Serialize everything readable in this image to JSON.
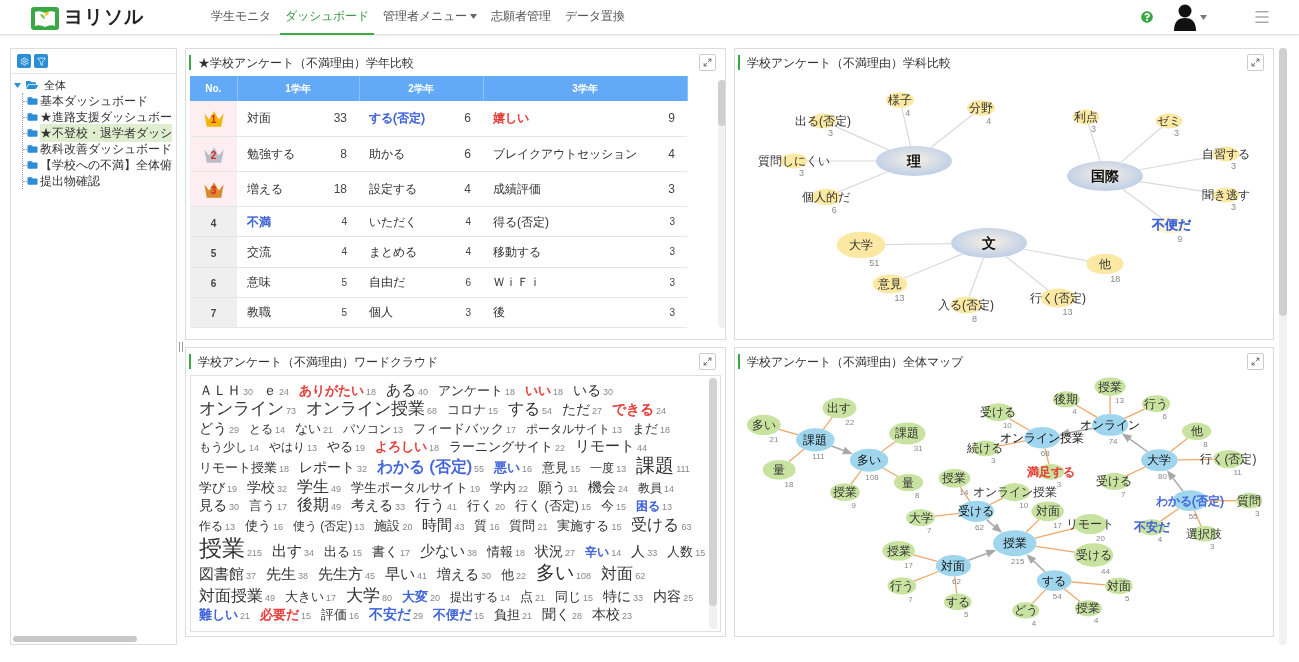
{
  "header": {
    "logo": "ヨリソル",
    "nav": [
      {
        "label": "学生モニタ",
        "selected": false,
        "has_menu": false
      },
      {
        "label": "ダッシュボード",
        "selected": true,
        "has_menu": false
      },
      {
        "label": "管理者メニュー",
        "selected": false,
        "has_menu": true
      },
      {
        "label": "志願者管理",
        "selected": false,
        "has_menu": false
      },
      {
        "label": "データ置換",
        "selected": false,
        "has_menu": false
      }
    ]
  },
  "sidebar": {
    "tree": [
      {
        "label": "全体",
        "expanded": true,
        "selected": false,
        "children": [
          {
            "label": "基本ダッシュボード",
            "selected": false
          },
          {
            "label": "★進路支援ダッシュボー",
            "selected": false
          },
          {
            "label": "★不登校・退学者ダッシ",
            "selected": true
          },
          {
            "label": "教科改善ダッシュボード",
            "selected": false
          },
          {
            "label": "【学校への不満】全体俯",
            "selected": false
          },
          {
            "label": "提出物確認",
            "selected": false
          }
        ]
      }
    ]
  },
  "grade_table": {
    "title": "★学校アンケート（不満理由）学年比較",
    "no_header": "No.",
    "grade_headers": [
      "1学年",
      "2学年",
      "3学年"
    ],
    "entries": [
      {
        "rank": "1",
        "kind": "gold",
        "grades": [
          {
            "word": "対面",
            "count": "33"
          },
          {
            "word": "する(否定)",
            "count": "6",
            "color": "#3b5fd8"
          },
          {
            "word": "嬉しい",
            "count": "9",
            "color": "#e53935"
          }
        ]
      },
      {
        "rank": "2",
        "kind": "silver",
        "grades": [
          {
            "word": "勉強する",
            "count": "8"
          },
          {
            "word": "助かる",
            "count": "6"
          },
          {
            "word": "ブレイクアウトセッション",
            "count": "4"
          }
        ]
      },
      {
        "rank": "3",
        "kind": "bronze",
        "grades": [
          {
            "word": "増える",
            "count": "18"
          },
          {
            "word": "設定する",
            "count": "4"
          },
          {
            "word": "成績評価",
            "count": "3"
          }
        ]
      },
      {
        "rank": "4",
        "kind": "plain",
        "grades": [
          {
            "word": "不満",
            "count": "4",
            "color": "#3b5fd8"
          },
          {
            "word": "いただく",
            "count": "4"
          },
          {
            "word": "得る(否定)",
            "count": "3"
          }
        ]
      },
      {
        "rank": "5",
        "kind": "plain",
        "grades": [
          {
            "word": "交流",
            "count": "4"
          },
          {
            "word": "まとめる",
            "count": "4"
          },
          {
            "word": "移動する",
            "count": "3"
          }
        ]
      },
      {
        "rank": "6",
        "kind": "plain",
        "grades": [
          {
            "word": "意味",
            "count": "5"
          },
          {
            "word": "自由だ",
            "count": "6"
          },
          {
            "word": "ＷｉＦｉ",
            "count": "3"
          }
        ]
      },
      {
        "rank": "7",
        "kind": "plain",
        "grades": [
          {
            "word": "教職",
            "count": "5"
          },
          {
            "word": "個人",
            "count": "3"
          },
          {
            "word": "後",
            "count": "3"
          }
        ]
      }
    ]
  },
  "department_map": {
    "title": "学校アンケート（不満理由）学科比較",
    "hubs": [
      {
        "label": "理",
        "leaves": [
          {
            "label": "様子",
            "count": "4"
          },
          {
            "label": "分野",
            "count": "4"
          },
          {
            "label": "出る(否定)",
            "count": "3"
          },
          {
            "label": "質問しにくい",
            "count": "3"
          },
          {
            "label": "個人的だ",
            "count": "6"
          }
        ]
      },
      {
        "label": "国際",
        "leaves": [
          {
            "label": "利点",
            "count": "3"
          },
          {
            "label": "ゼミ",
            "count": "3"
          },
          {
            "label": "自習する",
            "count": "3"
          },
          {
            "label": "聞き逃す",
            "count": "3"
          },
          {
            "label": "不便だ",
            "count": "9",
            "color": "#3b5fd8"
          }
        ]
      },
      {
        "label": "文",
        "leaves": [
          {
            "label": "大学",
            "count": "51"
          },
          {
            "label": "意見",
            "count": "13"
          },
          {
            "label": "入る(否定)",
            "count": "8"
          },
          {
            "label": "行く(否定)",
            "count": "13"
          },
          {
            "label": "他",
            "count": "18"
          }
        ]
      }
    ]
  },
  "word_cloud": {
    "title": "学校アンケート（不満理由）ワードクラウド",
    "words": [
      {
        "text": "ＡＬＨ",
        "count": "30"
      },
      {
        "text": "ｅ",
        "count": "24"
      },
      {
        "text": "ありがたい",
        "count": "18",
        "color": "#e53935"
      },
      {
        "text": "ある",
        "count": "40"
      },
      {
        "text": "アンケート",
        "count": "18"
      },
      {
        "text": "いい",
        "count": "18",
        "color": "#e53935"
      },
      {
        "text": "いる",
        "count": "30"
      },
      {
        "text": "オンライン",
        "count": "73"
      },
      {
        "text": "オンライン授業",
        "count": "68"
      },
      {
        "text": "コロナ",
        "count": "15"
      },
      {
        "text": "する",
        "count": "54"
      },
      {
        "text": "ただ",
        "count": "27"
      },
      {
        "text": "できる",
        "count": "24",
        "color": "#e53935"
      },
      {
        "text": "どう",
        "count": "29"
      },
      {
        "text": "とる",
        "count": "14"
      },
      {
        "text": "ない",
        "count": "21"
      },
      {
        "text": "パソコン",
        "count": "13"
      },
      {
        "text": "フィードバック",
        "count": "17"
      },
      {
        "text": "ポータルサイト",
        "count": "13"
      },
      {
        "text": "まだ",
        "count": "18"
      },
      {
        "text": "もう少し",
        "count": "14"
      },
      {
        "text": "やはり",
        "count": "13"
      },
      {
        "text": "やる",
        "count": "19"
      },
      {
        "text": "よろしい",
        "count": "18",
        "color": "#e53935"
      },
      {
        "text": "ラーニングサイト",
        "count": "22"
      },
      {
        "text": "リモート",
        "count": "44"
      },
      {
        "text": "リモート授業",
        "count": "18"
      },
      {
        "text": "レポート",
        "count": "32"
      },
      {
        "text": "わかる (否定)",
        "count": "55",
        "color": "#3b5fd8"
      },
      {
        "text": "悪い",
        "count": "16",
        "color": "#3b5fd8"
      },
      {
        "text": "意見",
        "count": "15"
      },
      {
        "text": "一度",
        "count": "13"
      },
      {
        "text": "課題",
        "count": "111"
      },
      {
        "text": "学び",
        "count": "19"
      },
      {
        "text": "学校",
        "count": "32"
      },
      {
        "text": "学生",
        "count": "49"
      },
      {
        "text": "学生ポータルサイト",
        "count": "19"
      },
      {
        "text": "学内",
        "count": "22"
      },
      {
        "text": "願う",
        "count": "31"
      },
      {
        "text": "機会",
        "count": "24"
      },
      {
        "text": "教員",
        "count": "14"
      },
      {
        "text": "見る",
        "count": "30"
      },
      {
        "text": "言う",
        "count": "17"
      },
      {
        "text": "後期",
        "count": "49"
      },
      {
        "text": "考える",
        "count": "33"
      },
      {
        "text": "行う",
        "count": "41"
      },
      {
        "text": "行く",
        "count": "20"
      },
      {
        "text": "行く (否定)",
        "count": "15"
      },
      {
        "text": "今",
        "count": "15"
      },
      {
        "text": "困る",
        "count": "13",
        "color": "#3b5fd8"
      },
      {
        "text": "作る",
        "count": "13"
      },
      {
        "text": "使う",
        "count": "16"
      },
      {
        "text": "使う (否定)",
        "count": "13"
      },
      {
        "text": "施設",
        "count": "20"
      },
      {
        "text": "時間",
        "count": "43"
      },
      {
        "text": "質",
        "count": "16"
      },
      {
        "text": "質問",
        "count": "21"
      },
      {
        "text": "実施する",
        "count": "15"
      },
      {
        "text": "受ける",
        "count": "63"
      },
      {
        "text": "授業",
        "count": "215"
      },
      {
        "text": "出す",
        "count": "34"
      },
      {
        "text": "出る",
        "count": "15"
      },
      {
        "text": "書く",
        "count": "17"
      },
      {
        "text": "少ない",
        "count": "38"
      },
      {
        "text": "情報",
        "count": "18"
      },
      {
        "text": "状況",
        "count": "27"
      },
      {
        "text": "辛い",
        "count": "14",
        "color": "#3b5fd8"
      },
      {
        "text": "人",
        "count": "33"
      },
      {
        "text": "人数",
        "count": "15"
      },
      {
        "text": "図書館",
        "count": "37"
      },
      {
        "text": "先生",
        "count": "38"
      },
      {
        "text": "先生方",
        "count": "45"
      },
      {
        "text": "早い",
        "count": "41"
      },
      {
        "text": "増える",
        "count": "30"
      },
      {
        "text": "他",
        "count": "22"
      },
      {
        "text": "多い",
        "count": "108"
      },
      {
        "text": "対面",
        "count": "62"
      },
      {
        "text": "対面授業",
        "count": "49"
      },
      {
        "text": "大きい",
        "count": "17"
      },
      {
        "text": "大学",
        "count": "80"
      },
      {
        "text": "大変",
        "count": "20",
        "color": "#3b5fd8"
      },
      {
        "text": "提出する",
        "count": "14"
      },
      {
        "text": "点",
        "count": "21"
      },
      {
        "text": "同じ",
        "count": "15"
      },
      {
        "text": "特に",
        "count": "33"
      },
      {
        "text": "内容",
        "count": "25"
      },
      {
        "text": "難しい",
        "count": "21",
        "color": "#3b5fd8"
      },
      {
        "text": "必要だ",
        "count": "15",
        "color": "#e53935"
      },
      {
        "text": "評価",
        "count": "16"
      },
      {
        "text": "不安だ",
        "count": "29",
        "color": "#3b5fd8"
      },
      {
        "text": "不便だ",
        "count": "15",
        "color": "#3b5fd8"
      },
      {
        "text": "負担",
        "count": "21"
      },
      {
        "text": "聞く",
        "count": "28"
      },
      {
        "text": "本校",
        "count": "23"
      }
    ]
  },
  "overall_map": {
    "title": "学校アンケート（不満理由）全体マップ",
    "hubs": [
      {
        "label": "課題",
        "count": "111",
        "leaves": [
          {
            "label": "出す",
            "count": "22"
          },
          {
            "label": "多い",
            "count": "21"
          },
          {
            "label": "量",
            "count": "18"
          }
        ]
      },
      {
        "label": "多い",
        "count": "108",
        "leaves": [
          {
            "label": "課題",
            "count": "31"
          },
          {
            "label": "量",
            "count": "8"
          },
          {
            "label": "授業",
            "count": "9"
          }
        ]
      },
      {
        "label": "オンライン授業",
        "count": "68",
        "leaves": [
          {
            "label": "受ける",
            "count": "10"
          },
          {
            "label": "続ける",
            "count": "3"
          },
          {
            "label": "満足する",
            "count": "3",
            "color": "#e53935"
          }
        ]
      },
      {
        "label": "オンライン",
        "count": "74",
        "leaves": [
          {
            "label": "後期",
            "count": "4"
          },
          {
            "label": "授業",
            "count": "13"
          },
          {
            "label": "行う",
            "count": "6"
          }
        ]
      },
      {
        "label": "大学",
        "count": "80",
        "leaves": [
          {
            "label": "他",
            "count": "8"
          },
          {
            "label": "行く(否定)",
            "count": "11"
          },
          {
            "label": "受ける",
            "count": "7"
          }
        ]
      },
      {
        "label": "わかる(否定)",
        "count": "55",
        "color": "#3b5fd8",
        "leaves": [
          {
            "label": "質問",
            "count": "3"
          },
          {
            "label": "不安だ",
            "count": "4",
            "color": "#3b5fd8"
          },
          {
            "label": "選択肢",
            "count": "3"
          }
        ]
      },
      {
        "label": "受ける",
        "count": "62",
        "leaves": [
          {
            "label": "授業",
            "count": "14"
          },
          {
            "label": "大学",
            "count": "7"
          },
          {
            "label": "オンライン授業",
            "count": "10"
          }
        ]
      },
      {
        "label": "授業",
        "count": "215",
        "leaves": [
          {
            "label": "対面",
            "count": "17"
          },
          {
            "label": "リモート",
            "count": "20"
          },
          {
            "label": "受ける",
            "count": "44"
          }
        ]
      },
      {
        "label": "対面",
        "count": "62",
        "leaves": [
          {
            "label": "授業",
            "count": "17"
          },
          {
            "label": "行う",
            "count": "7"
          },
          {
            "label": "する",
            "count": "5"
          }
        ]
      },
      {
        "label": "する",
        "count": "54",
        "leaves": [
          {
            "label": "対面",
            "count": "5"
          },
          {
            "label": "どう",
            "count": "4"
          },
          {
            "label": "授業",
            "count": "4"
          }
        ]
      }
    ]
  }
}
